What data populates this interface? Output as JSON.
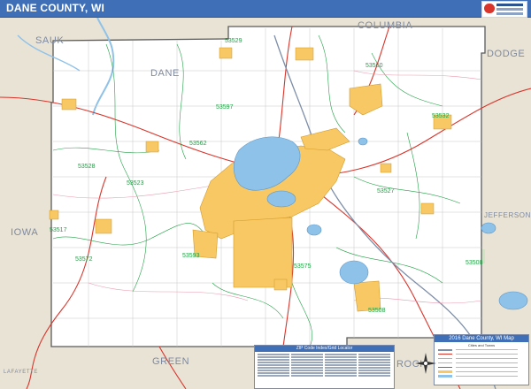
{
  "header": {
    "title": "DANE COUNTY, WI"
  },
  "map": {
    "neighbors": {
      "sauk": "SAUK",
      "columbia": "COLUMBIA",
      "dodge": "DODGE",
      "dane": "DANE",
      "iowa": "IOWA",
      "jefferson": "JEFFERSON",
      "green": "GREEN",
      "rock": "ROCK",
      "lafayette": "LAFAYETTE"
    },
    "zip_labels": [
      "53529",
      "53560",
      "53597",
      "53532",
      "53562",
      "53517",
      "53572",
      "53527",
      "53593",
      "53575",
      "53508",
      "53528",
      "53523",
      "53508"
    ],
    "colors": {
      "urban": "#f7c864",
      "water": "#8fc2e8",
      "county_area": "#ffffff",
      "outside_area": "#e9e3d6",
      "highway": "#d9352b",
      "boundary": "#5a5a5a",
      "zip_boundary": "#22a046",
      "local_road": "#b5b5b5",
      "header": "#3f6fb6"
    }
  },
  "legend": {
    "title": "2016 Dane County, WI Map",
    "subtitle": "Cities and Towns"
  },
  "zip_table": {
    "title": "ZIP Code Index/Grid Locator"
  }
}
